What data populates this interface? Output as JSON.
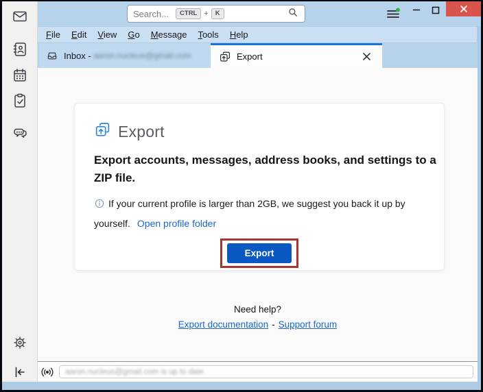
{
  "titlebar": {
    "search": {
      "placeholder": "Search...",
      "key_ctrl": "CTRL",
      "key_plus": "+",
      "key_k": "K"
    }
  },
  "menu": {
    "items": [
      "File",
      "Edit",
      "View",
      "Go",
      "Message",
      "Tools",
      "Help"
    ]
  },
  "tabs": {
    "inbox": {
      "label": "Inbox -",
      "email_redacted": "aaron.nucleus@gmail.com"
    },
    "export": {
      "label": "Export"
    }
  },
  "panel": {
    "title": "Export",
    "description": "Export accounts, messages, address books, and settings to a ZIP file.",
    "info": "If your current profile is larger than 2GB, we suggest you back it up by yourself.",
    "open_profile_link": "Open profile folder",
    "export_button": "Export"
  },
  "help": {
    "heading": "Need help?",
    "doc_link": "Export documentation",
    "separator": "-",
    "forum_link": "Support forum"
  },
  "statusbar": {
    "message_redacted": "aaron.nucleus@gmail.com is up to date"
  },
  "colors": {
    "titlebar_blue": "#b7d3ec",
    "active_tab_accent": "#1a73d9",
    "close_button_red": "#d9544d",
    "export_button_blue": "#0a58c2",
    "annotation_red": "#a6352c",
    "link_blue": "#1a66c9"
  }
}
